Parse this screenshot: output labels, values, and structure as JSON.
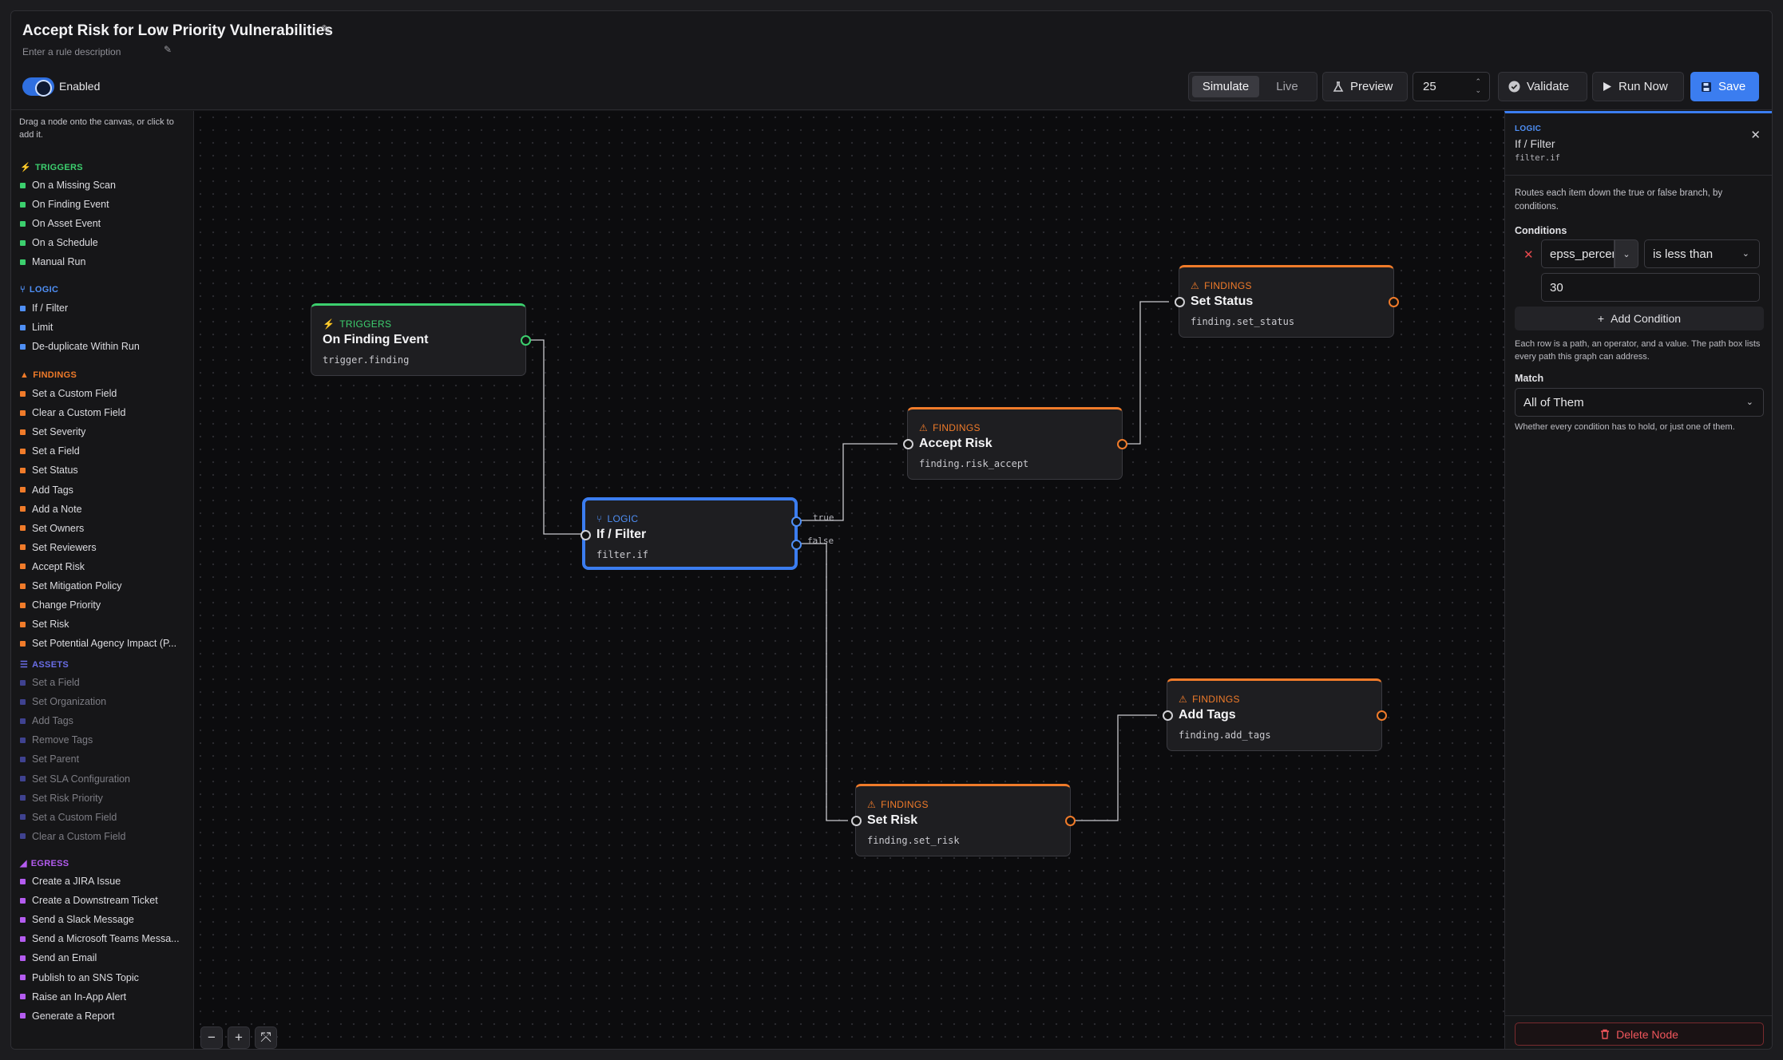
{
  "header": {
    "title": "Accept Risk for Low Priority Vulnerabilities",
    "description_placeholder": "Enter a rule description",
    "enabled_label": "Enabled",
    "mode_simulate": "Simulate",
    "mode_live": "Live",
    "preview_label": "Preview",
    "count_value": "25",
    "validate_label": "Validate",
    "run_label": "Run Now",
    "save_label": "Save"
  },
  "palette": {
    "hint": "Drag a node onto the canvas, or click to add it.",
    "triggers": {
      "label": "TRIGGERS",
      "color": "#3ccf6e",
      "items": [
        "On a Missing Scan",
        "On Finding Event",
        "On Asset Event",
        "On a Schedule",
        "Manual Run"
      ]
    },
    "logic": {
      "label": "LOGIC",
      "color": "#4f8ff5",
      "items": [
        "If / Filter",
        "Limit",
        "De-duplicate Within Run"
      ]
    },
    "findings": {
      "label": "FINDINGS",
      "color": "#f07b2a",
      "items": [
        "Set a Custom Field",
        "Clear a Custom Field",
        "Set Severity",
        "Set a Field",
        "Set Status",
        "Add Tags",
        "Add a Note",
        "Set Owners",
        "Set Reviewers",
        "Accept Risk",
        "Set Mitigation Policy",
        "Change Priority",
        "Set Risk",
        "Set Potential Agency Impact (P..."
      ]
    },
    "assets": {
      "label": "ASSETS",
      "color": "#6a6ee8",
      "items": [
        "Set a Field",
        "Set Organization",
        "Add Tags",
        "Remove Tags",
        "Set Parent",
        "Set SLA Configuration",
        "Set Risk Priority",
        "Set a Custom Field",
        "Clear a Custom Field"
      ]
    },
    "egress": {
      "label": "EGRESS",
      "color": "#b45cf0",
      "items": [
        "Create a JIRA Issue",
        "Create a Downstream Ticket",
        "Send a Slack Message",
        "Send a Microsoft Teams Messa...",
        "Send an Email",
        "Publish to an SNS Topic",
        "Raise an In-App Alert",
        "Generate a Report"
      ]
    }
  },
  "nodes": {
    "trigger": {
      "category": "TRIGGERS",
      "name": "On Finding Event",
      "op": "trigger.finding"
    },
    "filter": {
      "category": "LOGIC",
      "name": "If / Filter",
      "op": "filter.if"
    },
    "accept": {
      "category": "FINDINGS",
      "name": "Accept Risk",
      "op": "finding.risk_accept"
    },
    "status": {
      "category": "FINDINGS",
      "name": "Set Status",
      "op": "finding.set_status"
    },
    "tags": {
      "category": "FINDINGS",
      "name": "Add Tags",
      "op": "finding.add_tags"
    },
    "risk": {
      "category": "FINDINGS",
      "name": "Set Risk",
      "op": "finding.set_risk"
    }
  },
  "wires": {
    "true_label": "true",
    "false_label": "false"
  },
  "zoom": {
    "out": "−",
    "in": "+",
    "fit": "⤧"
  },
  "inspector": {
    "category": "LOGIC",
    "name": "If / Filter",
    "op": "filter.if",
    "description": "Routes each item down the true or false branch, by conditions.",
    "conditions_label": "Conditions",
    "condition_path": "epss_percentile",
    "condition_operator": "is less than",
    "condition_value": "30",
    "add_condition": "Add Condition",
    "conditions_hint": "Each row is a path, an operator, and a value. The path box lists every path this graph can address.",
    "match_label": "Match",
    "match_value": "All of Them",
    "match_hint": "Whether every condition has to hold, or just one of them.",
    "delete_label": "Delete Node"
  },
  "colors": {
    "accent": "#3b7df0",
    "trigger": "#3ccf6e",
    "logic": "#4f8ff5",
    "findings": "#f07b2a",
    "danger": "#e5484d"
  }
}
